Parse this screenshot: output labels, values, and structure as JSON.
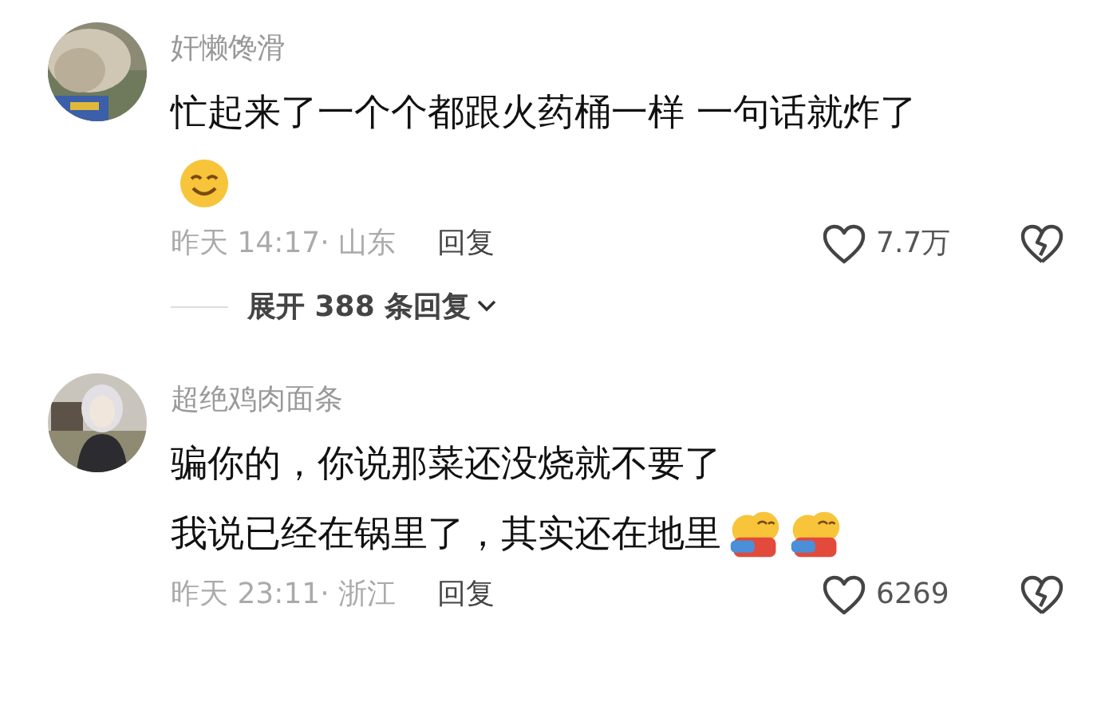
{
  "comments": [
    {
      "name": "奸懒馋滑",
      "lines": [
        {
          "text": "忙起来了一个个都跟火药桶一样 一句话就炸了"
        },
        {
          "stickers": [
            {
              "kind": "smile"
            }
          ]
        }
      ],
      "meta": "昨天 14:17· 山东",
      "reply": "回复",
      "likes": "7.7万",
      "liked": false,
      "expand": "展开 388 条回复"
    },
    {
      "name": "超绝鸡肉面条",
      "lines": [
        {
          "text": "骗你的，你说那菜还没烧就不要了"
        },
        {
          "text": "我说已经在锅里了，其实还在地里",
          "stickers": [
            {
              "kind": "hug"
            },
            {
              "kind": "hug"
            }
          ]
        }
      ],
      "meta": "昨天 23:11· 浙江",
      "reply": "回复",
      "likes": "6269",
      "liked": false
    }
  ]
}
